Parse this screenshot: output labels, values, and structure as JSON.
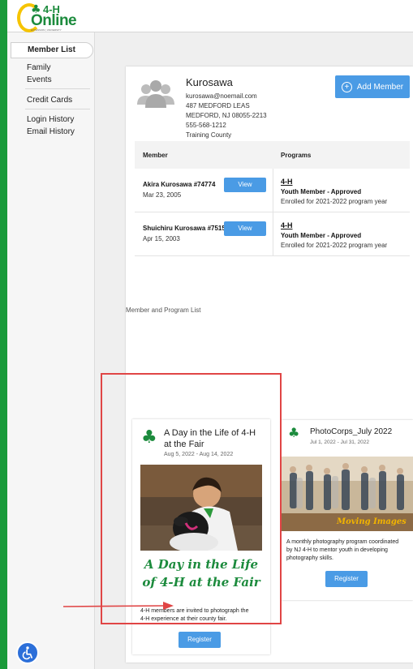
{
  "header": {
    "logo_top": "4-H",
    "logo_main": "Online",
    "logo_tag": "EXTENSION | UNIVERSITY"
  },
  "sidebar": {
    "items": [
      {
        "label": "Member List"
      },
      {
        "label": "Family"
      },
      {
        "label": "Events"
      },
      {
        "label": "Credit Cards"
      },
      {
        "label": "Login History"
      },
      {
        "label": "Email History"
      }
    ]
  },
  "family": {
    "name": "Kurosawa",
    "email": "kurosawa@noemail.com",
    "street": "487 MEDFORD LEAS",
    "city": "MEDFORD, NJ 08055-2213",
    "phone": "555-568-1212",
    "county": "Training County",
    "add_member_label": "Add Member"
  },
  "members_table": {
    "headers": {
      "member": "Member",
      "programs": "Programs"
    },
    "rows": [
      {
        "name": "Akira Kurosawa #74774",
        "dob": "Mar 23, 2005",
        "view_label": "View",
        "program": "4-H",
        "status": "Youth Member - Approved",
        "enrolled": "Enrolled for 2021-2022 program year"
      },
      {
        "name": "Shuichiru Kurosawa #75152",
        "dob": "Apr 15, 2003",
        "view_label": "View",
        "program": "4-H",
        "status": "Youth Member - Approved",
        "enrolled": "Enrolled for 2021-2022 program year"
      }
    ],
    "caption": "Member and Program List"
  },
  "events": [
    {
      "title_line1": "A Day in the Life of 4-H",
      "title_line2": "at the Fair",
      "dates": "Aug 5, 2022 - Aug 14, 2022",
      "banner_line1": "A Day in the Life",
      "banner_line2": "of 4-H at the Fair",
      "desc_line1": "4-H members are invited to photograph the",
      "desc_line2": "4-H experience at their county fair.",
      "register_label": "Register"
    },
    {
      "title": "PhotoCorps_July 2022",
      "dates": "Jul 1, 2022 - Jul 31, 2022",
      "image_text": "Moving Images",
      "desc_line1": "A monthly photography program coordinated",
      "desc_line2": "by NJ 4-H to mentor youth in developing",
      "desc_line3": "photography skills.",
      "register_label": "Register"
    }
  ],
  "colors": {
    "brand_green": "#1c8b3d",
    "accent_blue": "#4a9be5",
    "highlight_red": "#e04545"
  }
}
